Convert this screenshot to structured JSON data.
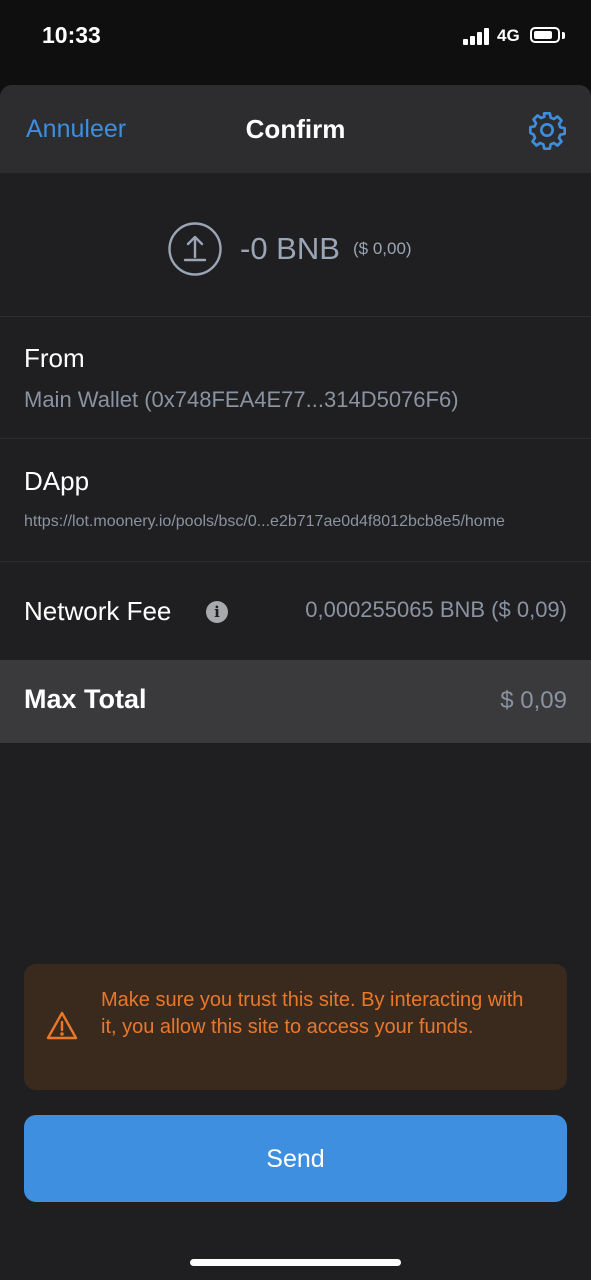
{
  "status_bar": {
    "time": "10:33",
    "network": "4G"
  },
  "header": {
    "cancel_label": "Annuleer",
    "title": "Confirm",
    "settings_icon": "gear-icon"
  },
  "amount": {
    "value": "-0 BNB",
    "fiat": "($ 0,00)",
    "icon": "upload-icon"
  },
  "from": {
    "label": "From",
    "value": "Main Wallet (0x748FEA4E77...314D5076F6)"
  },
  "dapp": {
    "label": "DApp",
    "value": "https://lot.moonery.io/pools/bsc/0...e2b717ae0d4f8012bcb8e5/home"
  },
  "network_fee": {
    "label": "Network Fee",
    "value": "0,000255065 BNB ($ 0,09)",
    "info_icon": "i"
  },
  "max_total": {
    "label": "Max Total",
    "value": "$ 0,09"
  },
  "warning": {
    "text": "Make sure you trust this site. By interacting with it, you allow this site to access your funds.",
    "icon": "warning-icon"
  },
  "send_label": "Send",
  "colors": {
    "accent": "#3f8fe0",
    "link": "#3d8ede",
    "warning": "#e9782b",
    "background": "#1f1f21"
  }
}
